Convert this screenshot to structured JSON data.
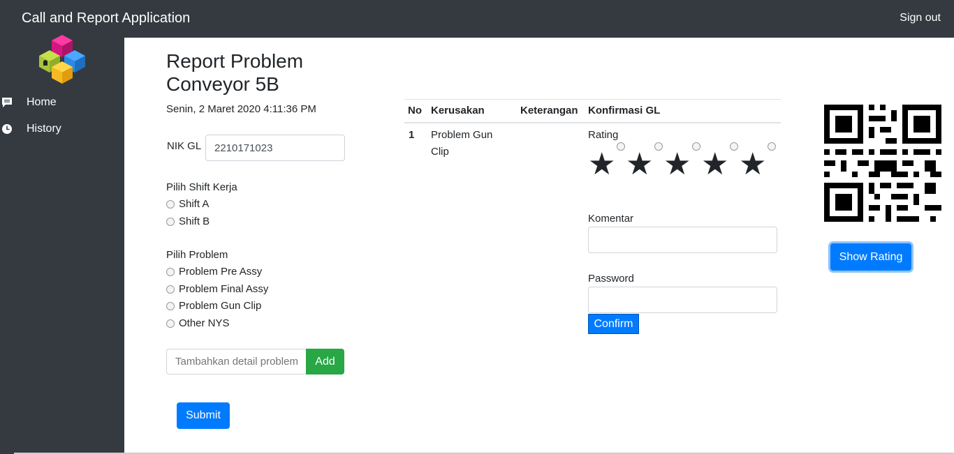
{
  "header": {
    "app_title": "Call and Report Application",
    "sign_out": "Sign out"
  },
  "sidebar": {
    "items": [
      {
        "label": "Home",
        "icon": "message-icon"
      },
      {
        "label": "History",
        "icon": "clock-icon"
      }
    ]
  },
  "report": {
    "title": "Report Problem Conveyor 5B",
    "date": "Senin, 2 Maret 2020 4:11:36 PM",
    "nik_label": "NIK GL",
    "nik_value": "2210171023",
    "shift_label": "Pilih Shift Kerja",
    "shifts": [
      "Shift A",
      "Shift B"
    ],
    "problem_label": "Pilih Problem",
    "problems": [
      "Problem Pre Assy",
      "Problem Final Assy",
      "Problem Gun Clip",
      "Other NYS"
    ],
    "detail_placeholder": "Tambahkan detail problem",
    "add_label": "Add",
    "submit_label": "Submit"
  },
  "table": {
    "headers": [
      "No",
      "Kerusakan",
      "Keterangan",
      "Konfirmasi GL"
    ],
    "rows": [
      {
        "no": "1",
        "kerusakan_line1": "Problem Gun",
        "kerusakan_line2": "Clip",
        "keterangan": ""
      }
    ]
  },
  "confirm": {
    "rating_label": "Rating",
    "komentar_label": "Komentar",
    "password_label": "Password",
    "confirm_label": "Confirm"
  },
  "qr": {
    "button_label": "Show Rating"
  },
  "colors": {
    "dark": "#343a40",
    "primary": "#007bff",
    "success": "#28a745"
  }
}
